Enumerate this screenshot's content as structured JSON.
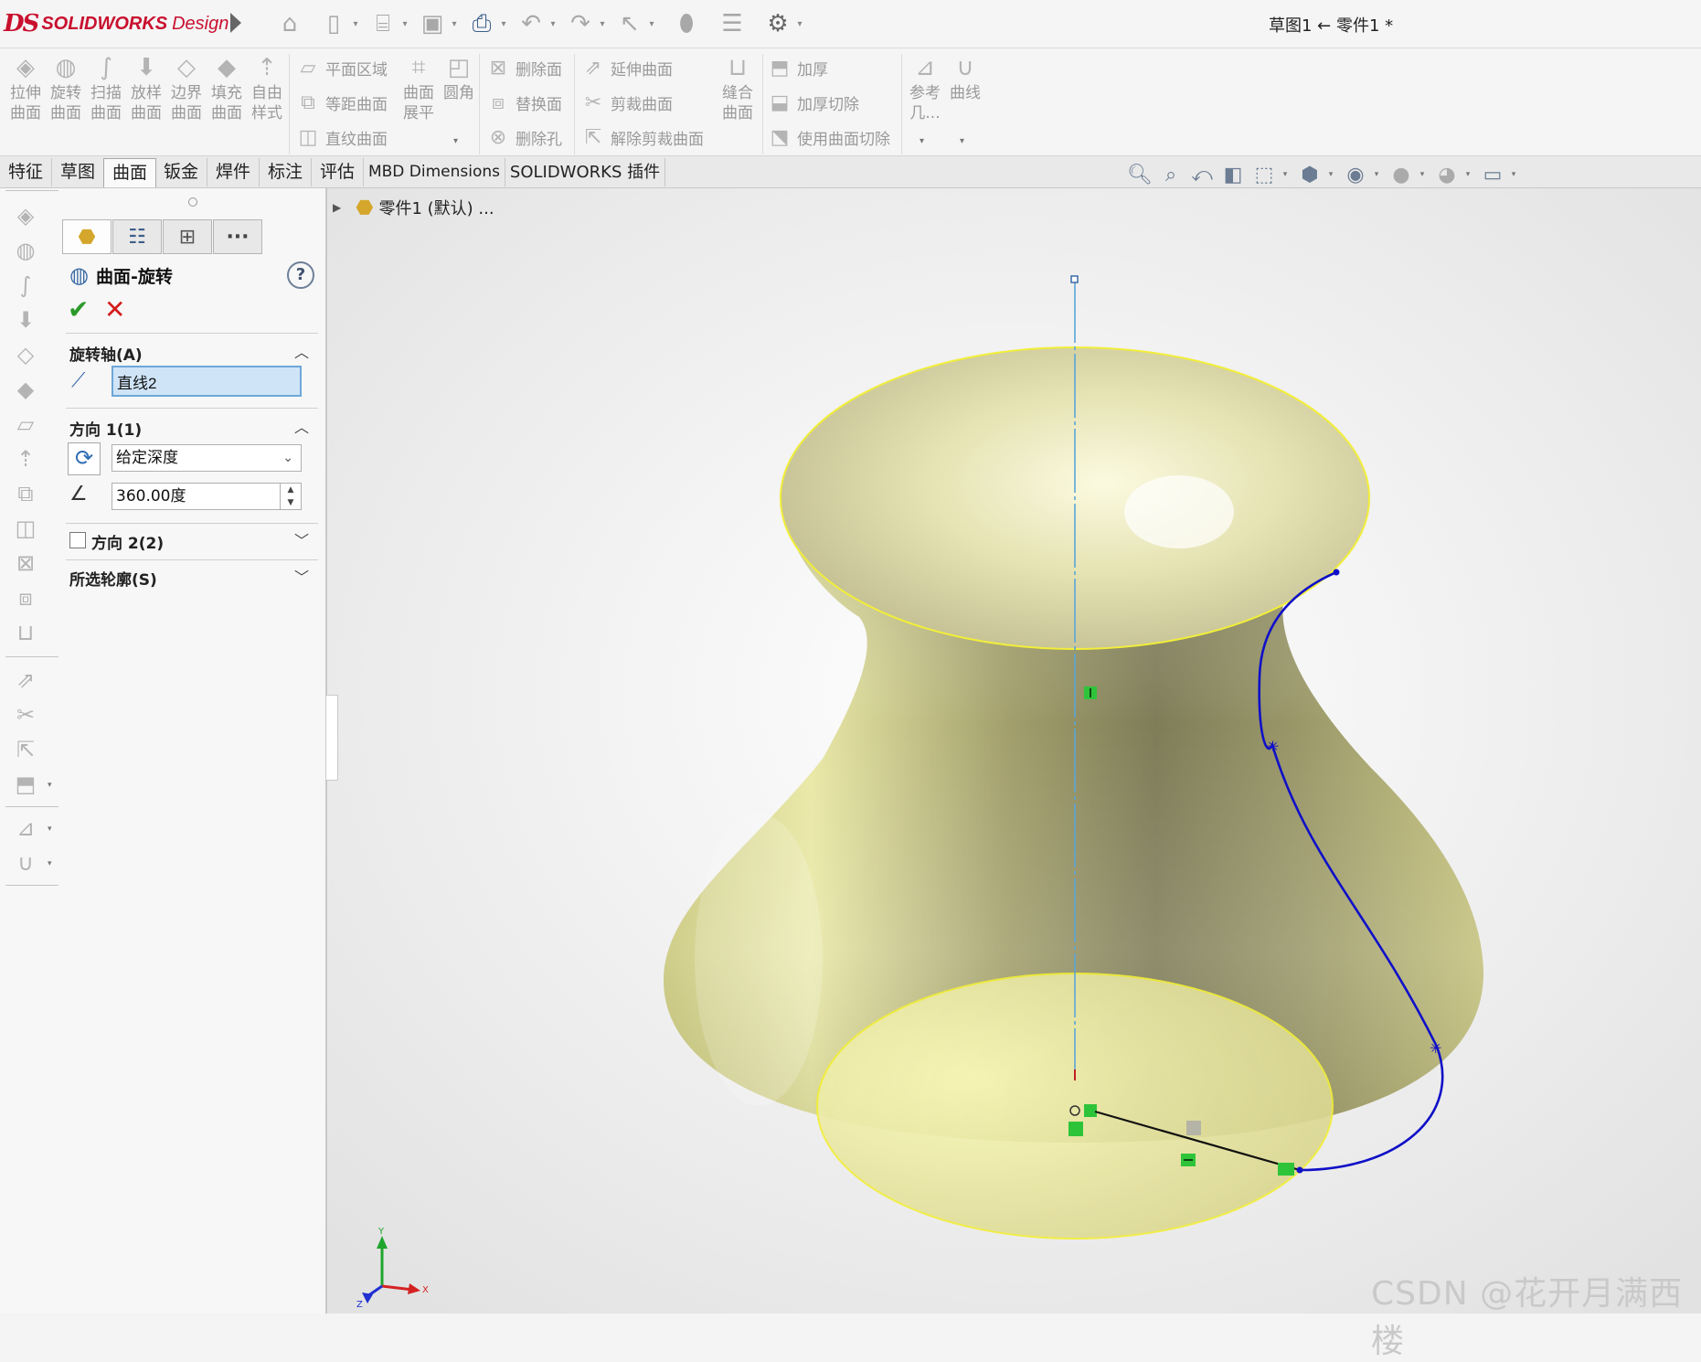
{
  "app": {
    "logo_mark": "DS",
    "brand": "SOLIDWORKS",
    "brand_suffix": "Design",
    "document_title": "草图1 ← 零件1 *"
  },
  "quick_access": [
    "home-icon",
    "new-document-icon",
    "open-icon",
    "save-icon",
    "print-icon",
    "undo-icon",
    "redo-icon",
    "select-icon",
    "rebuild-icon",
    "file-properties-icon",
    "options-icon"
  ],
  "ribbon": {
    "large_buttons": [
      {
        "line1": "拉伸",
        "line2": "曲面",
        "icon": "extruded-surface-icon"
      },
      {
        "line1": "旋转",
        "line2": "曲面",
        "icon": "revolved-surface-icon"
      },
      {
        "line1": "扫描",
        "line2": "曲面",
        "icon": "swept-surface-icon"
      },
      {
        "line1": "放样",
        "line2": "曲面",
        "icon": "lofted-surface-icon"
      },
      {
        "line1": "边界",
        "line2": "曲面",
        "icon": "boundary-surface-icon"
      },
      {
        "line1": "填充",
        "line2": "曲面",
        "icon": "filled-surface-icon"
      },
      {
        "line1": "自由",
        "line2": "样式",
        "icon": "freeform-icon"
      }
    ],
    "group2": [
      "平面区域",
      "等距曲面",
      "直纹曲面"
    ],
    "group2_large": [
      {
        "line1": "曲面",
        "line2": "展平"
      },
      {
        "line1": "圆角",
        "line2": ""
      }
    ],
    "group3": [
      "删除面",
      "替换面",
      "删除孔"
    ],
    "group4": [
      "延伸曲面",
      "剪裁曲面",
      "解除剪裁曲面"
    ],
    "group5_large": {
      "line1": "缝合",
      "line2": "曲面"
    },
    "group6": [
      "加厚",
      "加厚切除",
      "使用曲面切除"
    ],
    "group7": [
      {
        "line1": "参考",
        "line2": "几..."
      },
      {
        "line1": "曲线",
        "line2": ""
      }
    ]
  },
  "tabs": [
    "特征",
    "草图",
    "曲面",
    "钣金",
    "焊件",
    "标注",
    "评估",
    "MBD Dimensions",
    "SOLIDWORKS 插件"
  ],
  "active_tab": "曲面",
  "feature_tree": {
    "root_label": "零件1 (默认) ..."
  },
  "property_manager": {
    "title": "曲面-旋转",
    "help": "?",
    "ok": "✔",
    "cancel": "✕",
    "axis_section": {
      "label": "旋转轴(A)",
      "value": "直线2"
    },
    "direction1": {
      "label": "方向 1(1)",
      "end_condition": "给定深度",
      "angle": "360.00度"
    },
    "direction2": {
      "label": "方向 2(2)",
      "checked": false
    },
    "selected_contours": {
      "label": "所选轮廓(S)"
    }
  },
  "watermark": "CSDN @花开月满西楼",
  "colors": {
    "surface": "#d9d78c",
    "surface_edge": "#f2ee3a",
    "axis": "#5aa6d8",
    "profile": "#1010c8",
    "relation_marker": "#2ec43a",
    "accent_red": "#c8102e"
  }
}
